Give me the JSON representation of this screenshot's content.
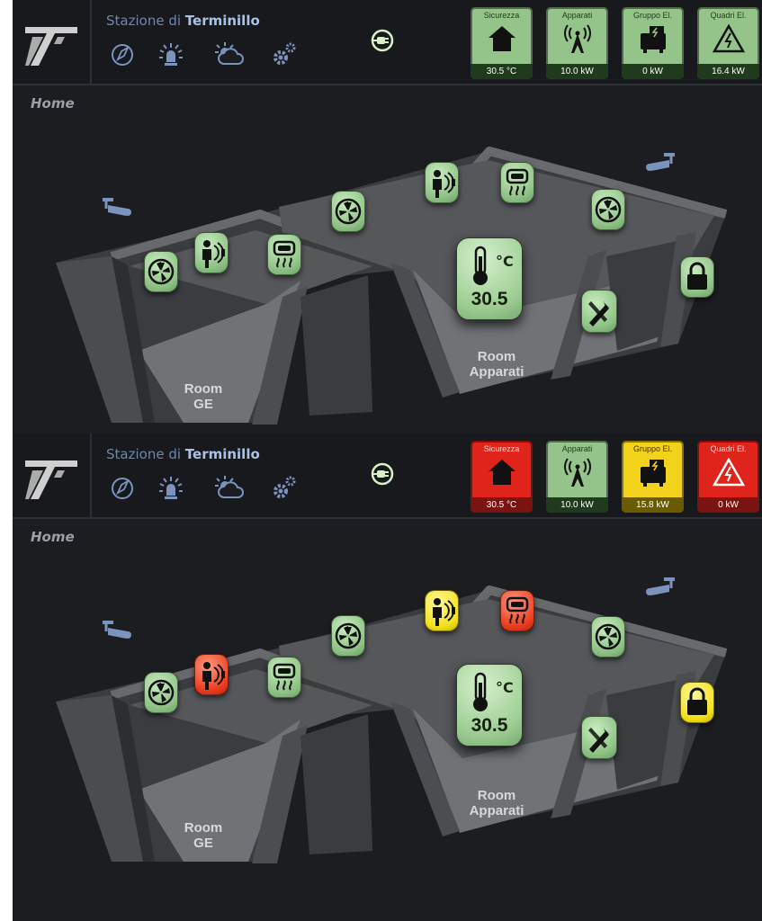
{
  "panel_a": {
    "header": {
      "station_prefix": "Stazione di ",
      "station_name": "Terminillo",
      "nav_icons": [
        "compass-icon",
        "siren-icon",
        "weather-icon",
        "gears-icon"
      ],
      "connection_icon": "plug-icon",
      "tiles": [
        {
          "title": "Sicurezza",
          "value": "30.5 °C",
          "status": "green",
          "icon": "house-icon"
        },
        {
          "title": "Apparati",
          "value": "10.0 kW",
          "status": "green",
          "icon": "antenna-icon"
        },
        {
          "title": "Gruppo El.",
          "value": "0 kW",
          "status": "green",
          "icon": "generator-icon"
        },
        {
          "title": "Quadri El.",
          "value": "16.4 kW",
          "status": "green",
          "icon": "high-voltage-icon"
        }
      ]
    },
    "breadcrumb": "Home",
    "rooms": {
      "left": [
        "Room",
        "GE"
      ],
      "right": [
        "Room",
        "Apparati"
      ]
    },
    "thermostat": {
      "unit": "°C",
      "value": "30.5",
      "status": "green"
    },
    "devices": {
      "ge_fan": "green",
      "ge_presence": "green",
      "ge_smoke": "green",
      "app_fan_left": "green",
      "app_presence": "green",
      "app_smoke": "green",
      "app_fan_right": "green",
      "app_tools": "green",
      "app_lock": "green"
    }
  },
  "panel_b": {
    "header": {
      "station_prefix": "Stazione di ",
      "station_name": "Terminillo",
      "nav_icons": [
        "compass-icon",
        "siren-icon",
        "weather-icon",
        "gears-icon"
      ],
      "connection_icon": "plug-icon",
      "tiles": [
        {
          "title": "Sicurezza",
          "value": "30.5 °C",
          "status": "red",
          "icon": "house-icon"
        },
        {
          "title": "Apparati",
          "value": "10.0 kW",
          "status": "green",
          "icon": "antenna-icon"
        },
        {
          "title": "Gruppo El.",
          "value": "15.8 kW",
          "status": "yellow",
          "icon": "generator-icon"
        },
        {
          "title": "Quadri El.",
          "value": "0 kW",
          "status": "red",
          "icon": "high-voltage-icon"
        }
      ]
    },
    "breadcrumb": "Home",
    "rooms": {
      "left": [
        "Room",
        "GE"
      ],
      "right": [
        "Room",
        "Apparati"
      ]
    },
    "thermostat": {
      "unit": "°C",
      "value": "30.5",
      "status": "green"
    },
    "devices": {
      "ge_fan": "green",
      "ge_presence": "red",
      "ge_smoke": "green",
      "app_fan_left": "green",
      "app_presence": "yellow",
      "app_smoke": "red",
      "app_fan_right": "green",
      "app_tools": "green",
      "app_lock": "yellow"
    }
  },
  "colors": {
    "green": "#95c48a",
    "red": "#e0231b",
    "yellow": "#f3d21c",
    "background": "#1b1d20",
    "accent_text": "#6f86ad"
  }
}
